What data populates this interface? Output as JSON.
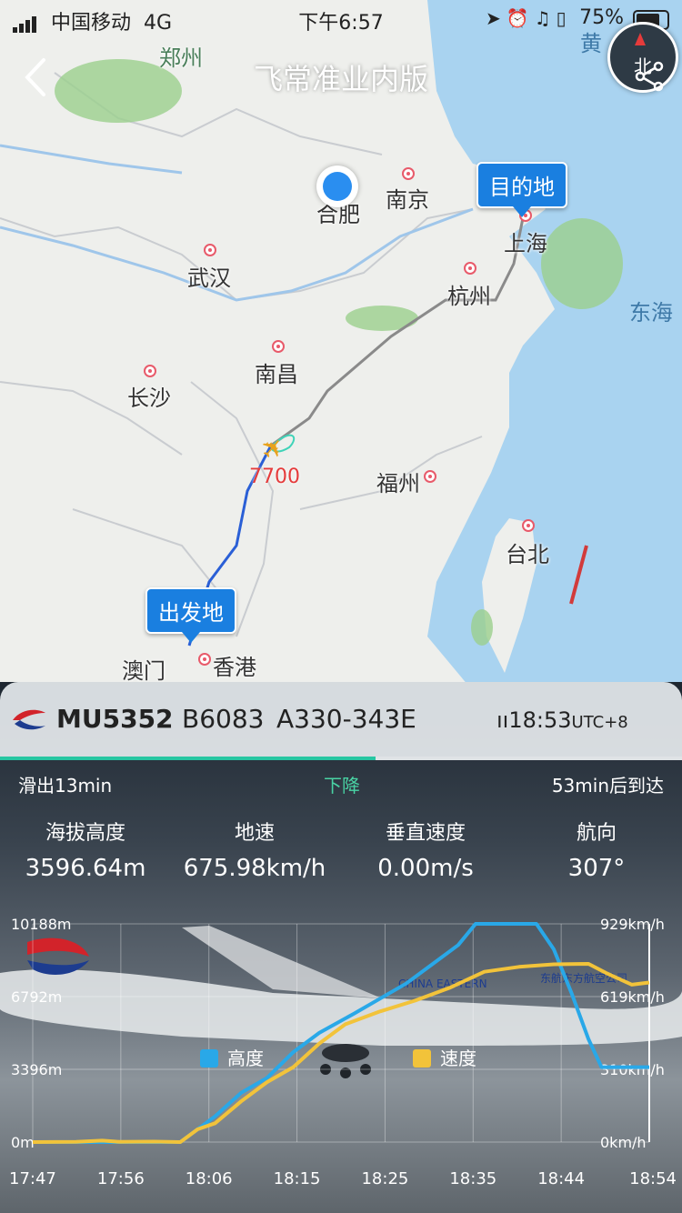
{
  "status_bar": {
    "carrier": "中国移动",
    "network": "4G",
    "time": "下午6:57",
    "battery": "75%"
  },
  "nav": {
    "title": "飞常准业内版",
    "compass_label": "北"
  },
  "map": {
    "cities": [
      "郑州",
      "合肥",
      "南京",
      "上海",
      "武汉",
      "杭州",
      "南昌",
      "长沙",
      "福州",
      "台北",
      "香港",
      "澳门"
    ],
    "seas": [
      "东海",
      "黄"
    ],
    "destination_label": "目的地",
    "origin_label": "出发地",
    "squawk": "7700",
    "route_color": "#8a8a8a"
  },
  "flight": {
    "number": "MU5352",
    "registration": "B6083",
    "aircraft": "A330-343E",
    "clock": "18:53",
    "tz": "UTC+8",
    "taxi_out": "滑出13min",
    "phase": "下降",
    "arrival": "53min后到达",
    "progress": 0.55,
    "stats": [
      {
        "label": "海拔高度",
        "value": "3596.64m"
      },
      {
        "label": "地速",
        "value": "675.98km/h"
      },
      {
        "label": "垂直速度",
        "value": "0.00m/s"
      },
      {
        "label": "航向",
        "value": "307°"
      }
    ]
  },
  "bg_aircraft_text": [
    "CHINA EASTERN",
    "东航东方航空公司"
  ],
  "chart_data": {
    "type": "line",
    "x": [
      "17:47",
      "17:56",
      "18:06",
      "18:15",
      "18:25",
      "18:35",
      "18:44",
      "18:54"
    ],
    "y_left_ticks": [
      "10188m",
      "6792m",
      "3396m",
      "0m"
    ],
    "y_right_ticks": [
      "929km/h",
      "619km/h",
      "310km/h",
      "0km/h"
    ],
    "ylim_left": [
      0,
      10188
    ],
    "ylim_right": [
      0,
      929
    ],
    "series": [
      {
        "name": "高度",
        "color": "#29a8e8",
        "points": [
          [
            0,
            0
          ],
          [
            17,
            0
          ],
          [
            21,
            1200
          ],
          [
            24,
            2300
          ],
          [
            27,
            3000
          ],
          [
            30,
            4200
          ],
          [
            33,
            5100
          ],
          [
            37,
            6000
          ],
          [
            40,
            6700
          ],
          [
            43,
            7400
          ],
          [
            46,
            8300
          ],
          [
            49,
            9200
          ],
          [
            51,
            10188
          ],
          [
            58,
            10188
          ],
          [
            60,
            9000
          ],
          [
            62,
            7000
          ],
          [
            64,
            4800
          ],
          [
            65.5,
            3500
          ],
          [
            71,
            3500
          ]
        ]
      },
      {
        "name": "速度",
        "color": "#f2c33a",
        "points": [
          [
            0,
            0
          ],
          [
            5,
            10
          ],
          [
            8,
            70
          ],
          [
            10,
            10
          ],
          [
            14,
            20
          ],
          [
            17,
            0
          ],
          [
            19,
            600
          ],
          [
            21,
            880
          ],
          [
            24,
            1900
          ],
          [
            27,
            2800
          ],
          [
            30,
            3500
          ],
          [
            33,
            4600
          ],
          [
            36,
            5500
          ],
          [
            40,
            6100
          ],
          [
            44,
            6600
          ],
          [
            48,
            7200
          ],
          [
            52,
            7950
          ],
          [
            56,
            8180
          ],
          [
            60,
            8300
          ],
          [
            64,
            8320
          ],
          [
            66,
            7900
          ],
          [
            69,
            7350
          ],
          [
            71,
            7450
          ]
        ]
      }
    ],
    "legend": [
      {
        "name": "高度",
        "color": "#29a8e8"
      },
      {
        "name": "速度",
        "color": "#f2c33a"
      }
    ]
  }
}
